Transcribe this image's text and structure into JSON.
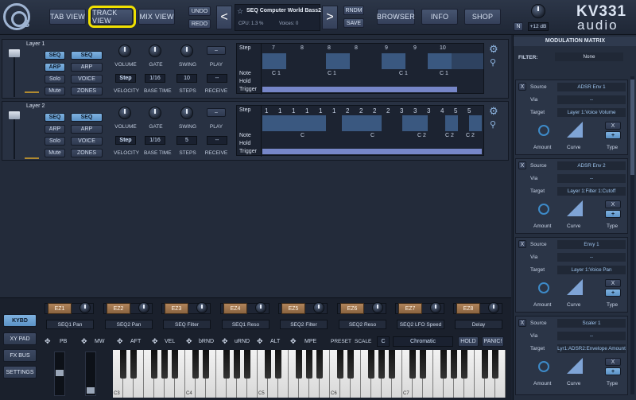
{
  "header": {
    "logo_digit": "3",
    "tabs": [
      {
        "label": "TAB VIEW",
        "active": false
      },
      {
        "label": "TRACK VIEW",
        "active": true
      },
      {
        "label": "MIX VIEW",
        "active": false
      }
    ],
    "undo": "UNDO",
    "redo": "REDO",
    "prev": "<",
    "next": ">",
    "preset_name": "SEQ Computer World Bass2",
    "cpu": "CPU: 1.3 %",
    "voices": "Voices: 0",
    "rndm": "RNDM",
    "save": "SAVE",
    "browser": "BROWSER",
    "info": "INFO",
    "shop": "SHOP",
    "n_label": "N",
    "gain": "+12 dB",
    "brand_top": "KV331",
    "brand_bottom": "audio"
  },
  "layers": [
    {
      "name": "Layer 1",
      "seq_left": "SEQ",
      "arp": "ARP",
      "solo": "Solo",
      "mute": "Mute",
      "seq_right": "SEQ",
      "arp_right": "ARP",
      "voice": "VOICE",
      "zones": "ZONES",
      "knob_labels": [
        "VOLUME",
        "GATE",
        "SWING",
        "PLAY"
      ],
      "values": [
        "Step",
        "1/16",
        "10",
        "--"
      ],
      "bottom_labels": [
        "VELOCITY",
        "BASE TIME",
        "STEPS",
        "RECEIVE"
      ],
      "step_label": "Step",
      "note_label": "Note",
      "hold_label": "Hold",
      "trigger_label": "Trigger",
      "steps": [
        "7",
        "8",
        "8",
        "8",
        "9",
        "9",
        "10"
      ],
      "notes": [
        "C 1",
        "C 1",
        "C 1",
        "C 1"
      ]
    },
    {
      "name": "Layer 2",
      "seq_left": "SEQ",
      "arp": "ARP",
      "solo": "Solo",
      "mute": "Mute",
      "seq_right": "SEQ",
      "arp_right": "ARP",
      "voice": "VOICE",
      "zones": "ZONES",
      "knob_labels": [
        "VOLUME",
        "GATE",
        "SWING",
        "PLAY"
      ],
      "values": [
        "Step",
        "1/16",
        "5",
        "--"
      ],
      "bottom_labels": [
        "VELOCITY",
        "BASE TIME",
        "STEPS",
        "RECEIVE"
      ],
      "step_label": "Step",
      "note_label": "Note",
      "hold_label": "Hold",
      "trigger_label": "Trigger",
      "steps": [
        "1",
        "1",
        "1",
        "1",
        "1",
        "1",
        "2",
        "2",
        "2",
        "2",
        "3",
        "3",
        "3",
        "4",
        "5",
        "5"
      ],
      "notes": [
        "C",
        "C",
        "C 2",
        "C 2",
        "C 2"
      ]
    }
  ],
  "mod_matrix": {
    "title": "MODULATION MATRIX",
    "filter_label": "FILTER:",
    "filter_value": "None",
    "slots": [
      {
        "x": "X",
        "source_label": "Source",
        "source": "ADSR Env 1",
        "via_label": "Via",
        "via": "--",
        "target_label": "Target",
        "target": "Layer 1:Voice Volume",
        "amount": "Amount",
        "curve": "Curve",
        "type": "Type",
        "type_x": "X",
        "type_plus": "+"
      },
      {
        "x": "X",
        "source_label": "Source",
        "source": "ADSR Env 2",
        "via_label": "Via",
        "via": "--",
        "target_label": "Target",
        "target": "Layer 1:Filter 1:Cutoff",
        "amount": "Amount",
        "curve": "Curve",
        "type": "Type",
        "type_x": "X",
        "type_plus": "+"
      },
      {
        "x": "X",
        "source_label": "Source",
        "source": "Envy 1",
        "via_label": "Via",
        "via": "--",
        "target_label": "Target",
        "target": "Layer 1:Voice Pan",
        "amount": "Amount",
        "curve": "Curve",
        "type": "Type",
        "type_x": "X",
        "type_plus": "+"
      },
      {
        "x": "X",
        "source_label": "Source",
        "source": "Scaler 1",
        "via_label": "Via",
        "via": "--",
        "target_label": "Target",
        "target": "Lyr1:ADSR2:Envelope Amount",
        "amount": "Amount",
        "curve": "Curve",
        "type": "Type",
        "type_x": "X",
        "type_plus": "+"
      }
    ]
  },
  "bottom": {
    "side_buttons": [
      "KYBD",
      "XY PAD",
      "FX BUS",
      "SETTINGS"
    ],
    "ez": [
      {
        "label": "EZ1",
        "name": "SEQ1 Pan"
      },
      {
        "label": "EZ2",
        "name": "SEQ2 Pan"
      },
      {
        "label": "EZ3",
        "name": "SEQ Filter"
      },
      {
        "label": "EZ4",
        "name": "SEQ1 Reso"
      },
      {
        "label": "EZ5",
        "name": "SEQ2 Filter"
      },
      {
        "label": "EZ6",
        "name": "SEQ2 Reso"
      },
      {
        "label": "EZ7",
        "name": "SEQ2 LFO Speed"
      },
      {
        "label": "EZ8",
        "name": "Delay"
      }
    ],
    "controls": [
      "PB",
      "MW",
      "AFT",
      "VEL",
      "bRND",
      "uRND",
      "ALT",
      "MPE"
    ],
    "preset": "PRESET",
    "scale": "SCALE",
    "scale_root": "C",
    "scale_type": "Chromatic",
    "hold": "HOLD",
    "panic": "PANIC!",
    "octave_labels": [
      "C3",
      "C4",
      "C5",
      "C6",
      "C7"
    ]
  }
}
